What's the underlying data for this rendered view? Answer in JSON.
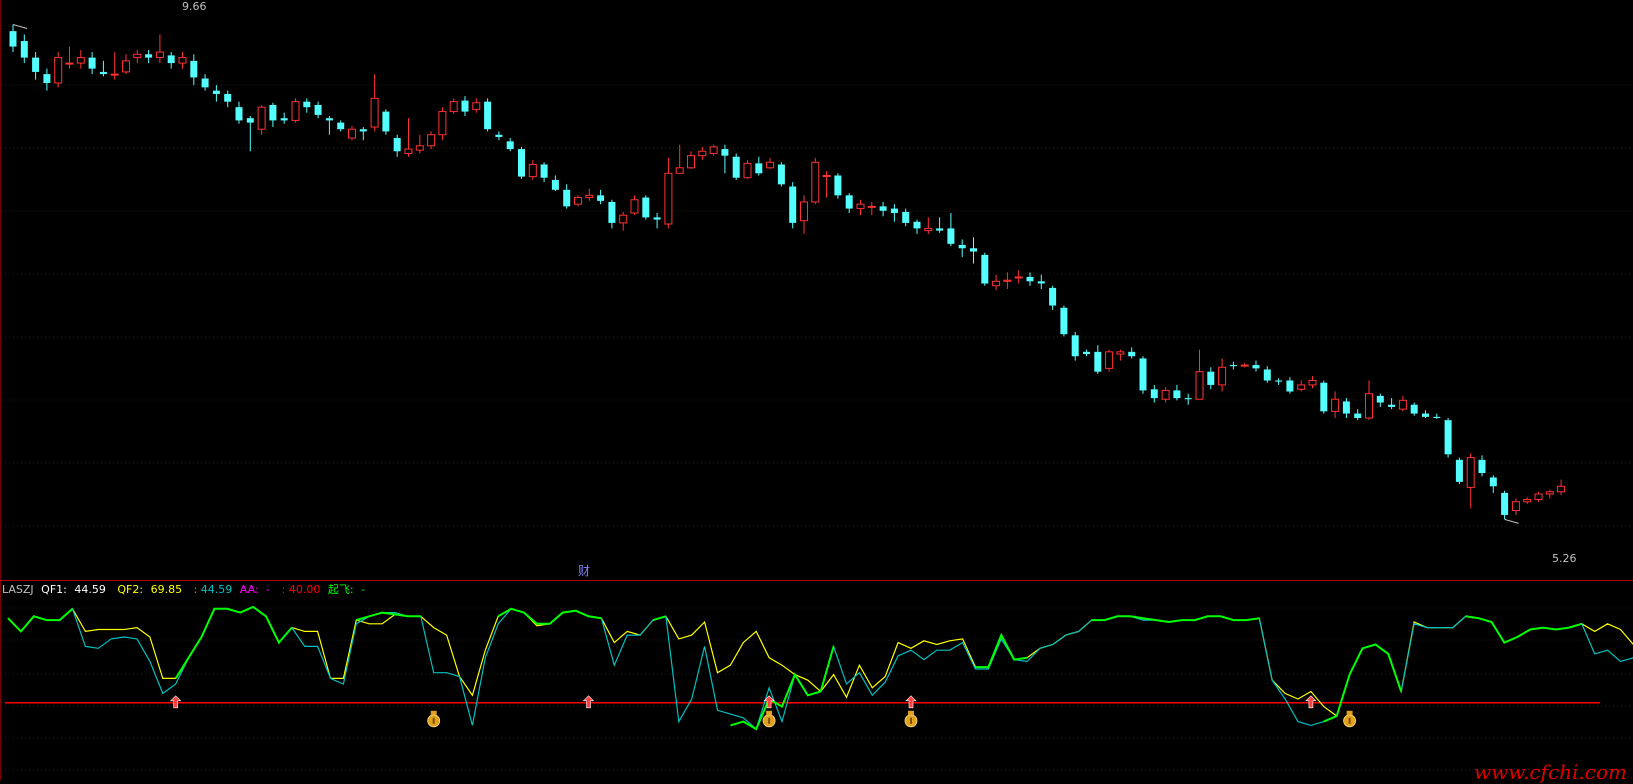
{
  "indicator": {
    "name": "LASZJ",
    "qf1_label": "QF1:",
    "qf1_value": "44.59",
    "qf2_label": "QF2:",
    "qf2_value": "69.85",
    "c3_value": ": 44.59",
    "aa_label": "AA:",
    "aa_value": "-",
    "c5_value": ": 40.00",
    "qifei_label": "起飞:",
    "qifei_value": "-",
    "colors": {
      "name": "#c0c0c0",
      "qf1": "#ffffff",
      "qf2": "#ffff00",
      "c3": "#00c0c0",
      "aa": "#ff00ff",
      "c5": "#ff0000",
      "qifei": "#00ff00"
    }
  },
  "cai_label": "财",
  "watermark": "www.cfchi.com",
  "max_label": "9.66",
  "min_label": "5.26",
  "chart_data": [
    {
      "type": "candlestick",
      "ylim": [
        5.0,
        9.9
      ],
      "grid": true,
      "up_color": "#ff3232",
      "down_color": "#54ffff",
      "candles": [
        [
          9.69,
          9.55,
          9.75,
          9.5
        ],
        [
          9.6,
          9.45,
          9.66,
          9.4
        ],
        [
          9.45,
          9.32,
          9.5,
          9.25
        ],
        [
          9.3,
          9.22,
          9.35,
          9.15
        ],
        [
          9.22,
          9.45,
          9.5,
          9.18
        ],
        [
          9.4,
          9.4,
          9.55,
          9.35
        ],
        [
          9.4,
          9.45,
          9.52,
          9.35
        ],
        [
          9.45,
          9.35,
          9.5,
          9.3
        ],
        [
          9.32,
          9.3,
          9.42,
          9.28
        ],
        [
          9.3,
          9.3,
          9.5,
          9.25
        ],
        [
          9.32,
          9.42,
          9.48,
          9.3
        ],
        [
          9.45,
          9.48,
          9.52,
          9.4
        ],
        [
          9.48,
          9.45,
          9.52,
          9.4
        ],
        [
          9.45,
          9.5,
          9.66,
          9.4
        ],
        [
          9.47,
          9.4,
          9.5,
          9.35
        ],
        [
          9.4,
          9.45,
          9.5,
          9.35
        ],
        [
          9.42,
          9.27,
          9.48,
          9.2
        ],
        [
          9.26,
          9.18,
          9.3,
          9.15
        ],
        [
          9.15,
          9.12,
          9.2,
          9.05
        ],
        [
          9.12,
          9.05,
          9.15,
          9.0
        ],
        [
          9.0,
          8.88,
          9.05,
          8.85
        ],
        [
          8.9,
          8.86,
          8.92,
          8.6
        ],
        [
          8.8,
          9.0,
          9.02,
          8.75
        ],
        [
          9.02,
          8.88,
          9.04,
          8.82
        ],
        [
          8.9,
          8.88,
          8.95,
          8.85
        ],
        [
          8.88,
          9.05,
          9.08,
          8.86
        ],
        [
          9.05,
          9.0,
          9.08,
          8.95
        ],
        [
          9.02,
          8.93,
          9.05,
          8.9
        ],
        [
          8.9,
          8.88,
          8.92,
          8.75
        ],
        [
          8.86,
          8.8,
          8.88,
          8.78
        ],
        [
          8.72,
          8.8,
          8.83,
          8.7
        ],
        [
          8.8,
          8.78,
          8.82,
          8.7
        ],
        [
          8.82,
          9.08,
          9.3,
          8.78
        ],
        [
          8.96,
          8.78,
          8.98,
          8.75
        ],
        [
          8.72,
          8.6,
          8.75,
          8.55
        ],
        [
          8.58,
          8.62,
          8.9,
          8.55
        ],
        [
          8.61,
          8.65,
          8.75,
          8.58
        ],
        [
          8.65,
          8.75,
          8.78,
          8.62
        ],
        [
          8.75,
          8.96,
          9.0,
          8.7
        ],
        [
          8.96,
          9.05,
          9.08,
          8.94
        ],
        [
          9.06,
          8.96,
          9.1,
          8.92
        ],
        [
          8.98,
          9.04,
          9.08,
          8.95
        ],
        [
          9.05,
          8.8,
          9.08,
          8.78
        ],
        [
          8.75,
          8.73,
          8.78,
          8.7
        ],
        [
          8.69,
          8.62,
          8.72,
          8.6
        ],
        [
          8.62,
          8.37,
          8.64,
          8.35
        ],
        [
          8.37,
          8.48,
          8.52,
          8.34
        ],
        [
          8.48,
          8.36,
          8.5,
          8.32
        ],
        [
          8.34,
          8.25,
          8.38,
          8.24
        ],
        [
          8.25,
          8.1,
          8.3,
          8.08
        ],
        [
          8.12,
          8.18,
          8.2,
          8.1
        ],
        [
          8.18,
          8.2,
          8.26,
          8.15
        ],
        [
          8.2,
          8.15,
          8.25,
          8.12
        ],
        [
          8.14,
          7.95,
          8.16,
          7.9
        ],
        [
          7.95,
          8.02,
          8.05,
          7.88
        ],
        [
          8.04,
          8.16,
          8.2,
          8.02
        ],
        [
          8.18,
          8.0,
          8.2,
          7.98
        ],
        [
          8.0,
          7.98,
          8.04,
          7.9
        ],
        [
          7.94,
          8.4,
          8.54,
          7.9
        ],
        [
          8.4,
          8.45,
          8.66,
          8.42
        ],
        [
          8.45,
          8.56,
          8.6,
          8.44
        ],
        [
          8.56,
          8.6,
          8.64,
          8.52
        ],
        [
          8.58,
          8.64,
          8.66,
          8.56
        ],
        [
          8.62,
          8.56,
          8.66,
          8.4
        ],
        [
          8.55,
          8.36,
          8.58,
          8.34
        ],
        [
          8.36,
          8.49,
          8.52,
          8.35
        ],
        [
          8.49,
          8.4,
          8.55,
          8.38
        ],
        [
          8.45,
          8.5,
          8.54,
          8.44
        ],
        [
          8.48,
          8.3,
          8.5,
          8.28
        ],
        [
          8.28,
          7.95,
          8.32,
          7.9
        ],
        [
          7.97,
          8.14,
          8.2,
          7.85
        ],
        [
          8.14,
          8.5,
          8.54,
          8.12
        ],
        [
          8.38,
          8.38,
          8.42,
          8.18
        ],
        [
          8.38,
          8.2,
          8.4,
          8.17
        ],
        [
          8.2,
          8.08,
          8.22,
          8.04
        ],
        [
          8.08,
          8.12,
          8.16,
          8.02
        ],
        [
          8.1,
          8.1,
          8.14,
          8.02
        ],
        [
          8.1,
          8.06,
          8.14,
          8.01
        ],
        [
          8.08,
          8.04,
          8.12,
          7.96
        ],
        [
          8.05,
          7.95,
          8.08,
          7.92
        ],
        [
          7.96,
          7.9,
          7.98,
          7.85
        ],
        [
          7.88,
          7.9,
          8.0,
          7.85
        ],
        [
          7.9,
          7.88,
          8.0,
          7.86
        ],
        [
          7.9,
          7.76,
          8.04,
          7.74
        ],
        [
          7.75,
          7.72,
          7.8,
          7.64
        ],
        [
          7.72,
          7.69,
          7.82,
          7.58
        ],
        [
          7.66,
          7.4,
          7.68,
          7.38
        ],
        [
          7.38,
          7.42,
          7.48,
          7.34
        ],
        [
          7.42,
          7.43,
          7.5,
          7.35
        ],
        [
          7.45,
          7.46,
          7.52,
          7.4
        ],
        [
          7.46,
          7.42,
          7.5,
          7.38
        ],
        [
          7.42,
          7.4,
          7.48,
          7.35
        ],
        [
          7.36,
          7.2,
          7.38,
          7.16
        ],
        [
          7.18,
          6.94,
          7.2,
          6.92
        ],
        [
          6.93,
          6.74,
          6.96,
          6.7
        ],
        [
          6.78,
          6.76,
          6.8,
          6.74
        ],
        [
          6.78,
          6.6,
          6.84,
          6.58
        ],
        [
          6.63,
          6.78,
          6.8,
          6.6
        ],
        [
          6.76,
          6.78,
          6.8,
          6.7
        ],
        [
          6.78,
          6.74,
          6.82,
          6.72
        ],
        [
          6.72,
          6.43,
          6.74,
          6.4
        ],
        [
          6.44,
          6.36,
          6.48,
          6.32
        ],
        [
          6.35,
          6.43,
          6.46,
          6.32
        ],
        [
          6.43,
          6.36,
          6.48,
          6.34
        ],
        [
          6.36,
          6.35,
          6.4,
          6.3
        ],
        [
          6.35,
          6.6,
          6.8,
          6.35
        ],
        [
          6.6,
          6.48,
          6.64,
          6.44
        ],
        [
          6.48,
          6.64,
          6.72,
          6.42
        ],
        [
          6.66,
          6.65,
          6.69,
          6.62
        ],
        [
          6.66,
          6.66,
          6.68,
          6.64
        ],
        [
          6.66,
          6.63,
          6.7,
          6.6
        ],
        [
          6.62,
          6.52,
          6.65,
          6.5
        ],
        [
          6.52,
          6.51,
          6.54,
          6.48
        ],
        [
          6.52,
          6.42,
          6.55,
          6.4
        ],
        [
          6.44,
          6.48,
          6.52,
          6.42
        ],
        [
          6.48,
          6.52,
          6.56,
          6.45
        ],
        [
          6.5,
          6.24,
          6.52,
          6.22
        ],
        [
          6.24,
          6.35,
          6.42,
          6.18
        ],
        [
          6.33,
          6.22,
          6.36,
          6.18
        ],
        [
          6.22,
          6.18,
          6.26,
          6.16
        ],
        [
          6.18,
          6.4,
          6.52,
          6.16
        ],
        [
          6.38,
          6.32,
          6.4,
          6.28
        ],
        [
          6.3,
          6.28,
          6.36,
          6.26
        ],
        [
          6.26,
          6.34,
          6.38,
          6.24
        ],
        [
          6.3,
          6.22,
          6.32,
          6.2
        ],
        [
          6.22,
          6.19,
          6.25,
          6.18
        ],
        [
          6.19,
          6.18,
          6.22,
          6.17
        ],
        [
          6.16,
          5.85,
          6.18,
          5.82
        ],
        [
          5.8,
          5.6,
          5.82,
          5.58
        ],
        [
          5.55,
          5.82,
          5.86,
          5.36
        ],
        [
          5.8,
          5.68,
          5.84,
          5.65
        ],
        [
          5.64,
          5.56,
          5.66,
          5.5
        ],
        [
          5.5,
          5.3,
          5.52,
          5.26
        ],
        [
          5.34,
          5.42,
          5.45,
          5.3
        ],
        [
          5.42,
          5.44,
          5.46,
          5.4
        ],
        [
          5.44,
          5.49,
          5.51,
          5.42
        ],
        [
          5.49,
          5.51,
          5.53,
          5.45
        ],
        [
          5.51,
          5.56,
          5.62,
          5.48
        ]
      ]
    },
    {
      "type": "line",
      "ylim": [
        0,
        100
      ],
      "reference_line": {
        "value": 40,
        "color": "#ff0000"
      },
      "series": [
        {
          "color": "#ffff00",
          "values": [
            85,
            78,
            86,
            84,
            84,
            90,
            78,
            79,
            79,
            79,
            80,
            75,
            53,
            53,
            64,
            75,
            90,
            90,
            88,
            91,
            86,
            72,
            80,
            78,
            78,
            53,
            53,
            84,
            82,
            82,
            87,
            86,
            86,
            80,
            76,
            54,
            44,
            68,
            86,
            90,
            88,
            81,
            82,
            88,
            89,
            86,
            85,
            72,
            78,
            76,
            84,
            86,
            74,
            76,
            83,
            56,
            60,
            72,
            78,
            64,
            60,
            55,
            52,
            46,
            55,
            43,
            60,
            48,
            54,
            72,
            69,
            73,
            71,
            73,
            74,
            59,
            59,
            76,
            63,
            64,
            69,
            71,
            76,
            78,
            84,
            84,
            86,
            86,
            85,
            84,
            83,
            84,
            84,
            86,
            86,
            84,
            84,
            85,
            52,
            45,
            42,
            46,
            38,
            33,
            55,
            69,
            71,
            66,
            46,
            83,
            80,
            80,
            80,
            86,
            85,
            83,
            72,
            75,
            79,
            80,
            79,
            80,
            82,
            78,
            82,
            79,
            71,
            70,
            65
          ]
        },
        {
          "color": "#00c0c0",
          "values": [
            85,
            78,
            86,
            84,
            84,
            90,
            70,
            69,
            74,
            75,
            74,
            62,
            45,
            50,
            64,
            75,
            90,
            90,
            88,
            91,
            86,
            72,
            80,
            70,
            70,
            53,
            50,
            82,
            86,
            88,
            88,
            86,
            86,
            56,
            56,
            54,
            28,
            64,
            82,
            90,
            88,
            82,
            82,
            88,
            89,
            86,
            85,
            60,
            76,
            76,
            84,
            86,
            30,
            42,
            70,
            36,
            34,
            32,
            26,
            48,
            30,
            55,
            44,
            46,
            70,
            50,
            56,
            44,
            51,
            65,
            68,
            63,
            68,
            68,
            72,
            58,
            58,
            74,
            63,
            62,
            69,
            71,
            76,
            78,
            84,
            84,
            86,
            86,
            84,
            84,
            83,
            84,
            84,
            86,
            86,
            84,
            84,
            85,
            52,
            42,
            30,
            28,
            30,
            33,
            55,
            69,
            71,
            66,
            46,
            82,
            80,
            80,
            80,
            86,
            85,
            83,
            72,
            75,
            79,
            80,
            79,
            80,
            82,
            66,
            68,
            62,
            64,
            58,
            46
          ]
        },
        {
          "color": "#00ff00",
          "values": [
            85,
            78,
            86,
            84,
            84,
            90,
            null,
            null,
            null,
            null,
            null,
            null,
            null,
            53,
            64,
            75,
            90,
            90,
            88,
            91,
            86,
            72,
            80,
            null,
            null,
            53,
            null,
            84,
            86,
            88,
            87,
            86,
            86,
            null,
            null,
            54,
            null,
            null,
            86,
            90,
            88,
            82,
            82,
            88,
            89,
            86,
            85,
            null,
            null,
            null,
            84,
            86,
            null,
            null,
            null,
            null,
            28,
            30,
            26,
            42,
            38,
            55,
            44,
            46,
            70,
            null,
            null,
            null,
            null,
            null,
            null,
            null,
            null,
            null,
            null,
            59,
            59,
            76,
            63,
            64,
            null,
            null,
            null,
            null,
            84,
            84,
            86,
            86,
            85,
            84,
            83,
            84,
            84,
            86,
            86,
            84,
            84,
            85,
            null,
            null,
            null,
            null,
            30,
            33,
            55,
            69,
            71,
            66,
            46,
            null,
            80,
            null,
            null,
            86,
            85,
            83,
            72,
            75,
            79,
            80,
            79,
            80,
            82,
            null,
            null,
            null,
            null,
            null,
            null
          ]
        }
      ],
      "buy_arrows": [
        13,
        45,
        59,
        70,
        101
      ],
      "money_bags": [
        33,
        59,
        70,
        104
      ]
    }
  ]
}
